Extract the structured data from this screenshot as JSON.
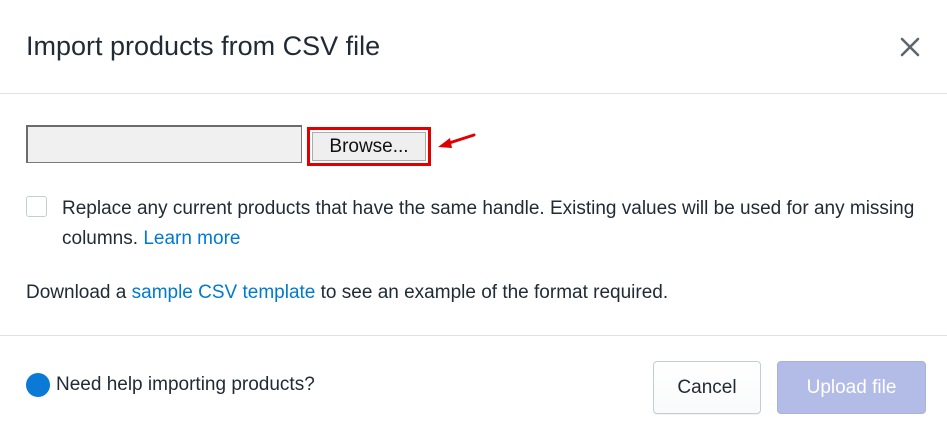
{
  "modal": {
    "title": "Import products from CSV file",
    "close_icon": "close-icon"
  },
  "file_input": {
    "value": "",
    "browse_label": "Browse..."
  },
  "replace_option": {
    "checked": false,
    "label": "Replace any current products that have the same handle. Existing values will be used for any missing columns.",
    "link_text": "Learn more"
  },
  "download": {
    "prefix": "Download a",
    "link_text": "sample CSV template",
    "suffix": "to see an example of the format required."
  },
  "footer": {
    "help_icon": "help-circle-icon",
    "help_text": "Need help importing products?",
    "cancel_label": "Cancel",
    "upload_label": "Upload file"
  },
  "colors": {
    "link": "#007ace",
    "highlight": "#e00000",
    "upload_disabled": "#b3bce6",
    "help_icon": "#0a7ad6"
  }
}
